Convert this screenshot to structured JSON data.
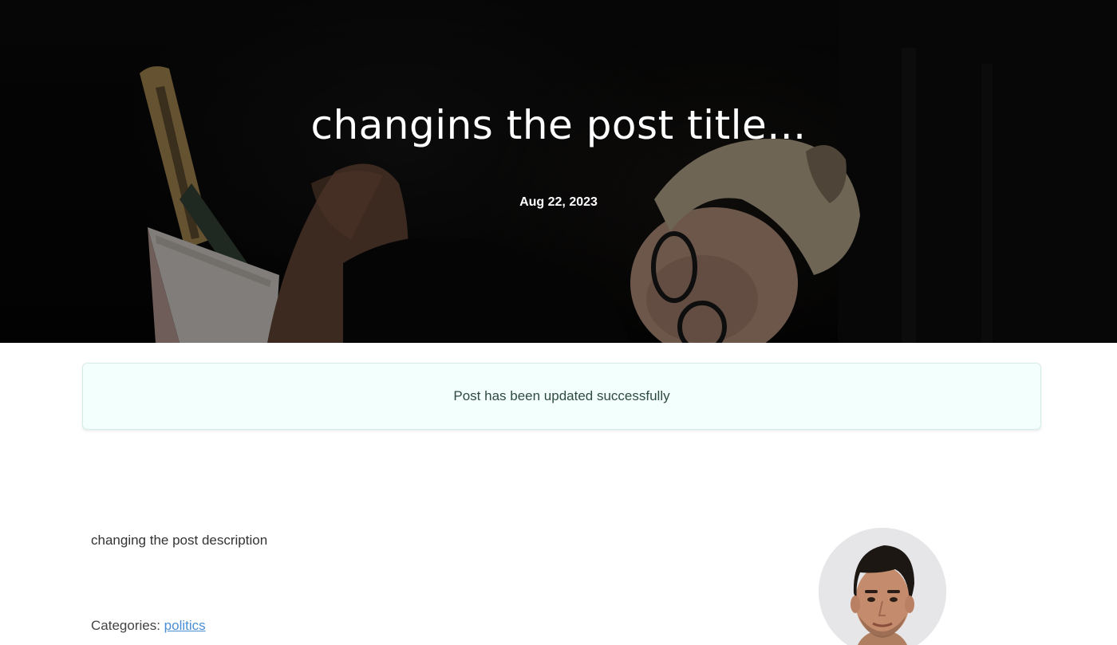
{
  "hero": {
    "title": "changins the post title...",
    "date": "Aug 22, 2023"
  },
  "alert": {
    "message": "Post has been updated successfully",
    "background": "#f3fffd",
    "text_color": "#2e4a3f"
  },
  "post": {
    "description": "changing the post description",
    "categories_label": "Categories:",
    "category_link": "politics"
  },
  "colors": {
    "link": "#4a8fd6",
    "hero_text": "#ffffff"
  }
}
